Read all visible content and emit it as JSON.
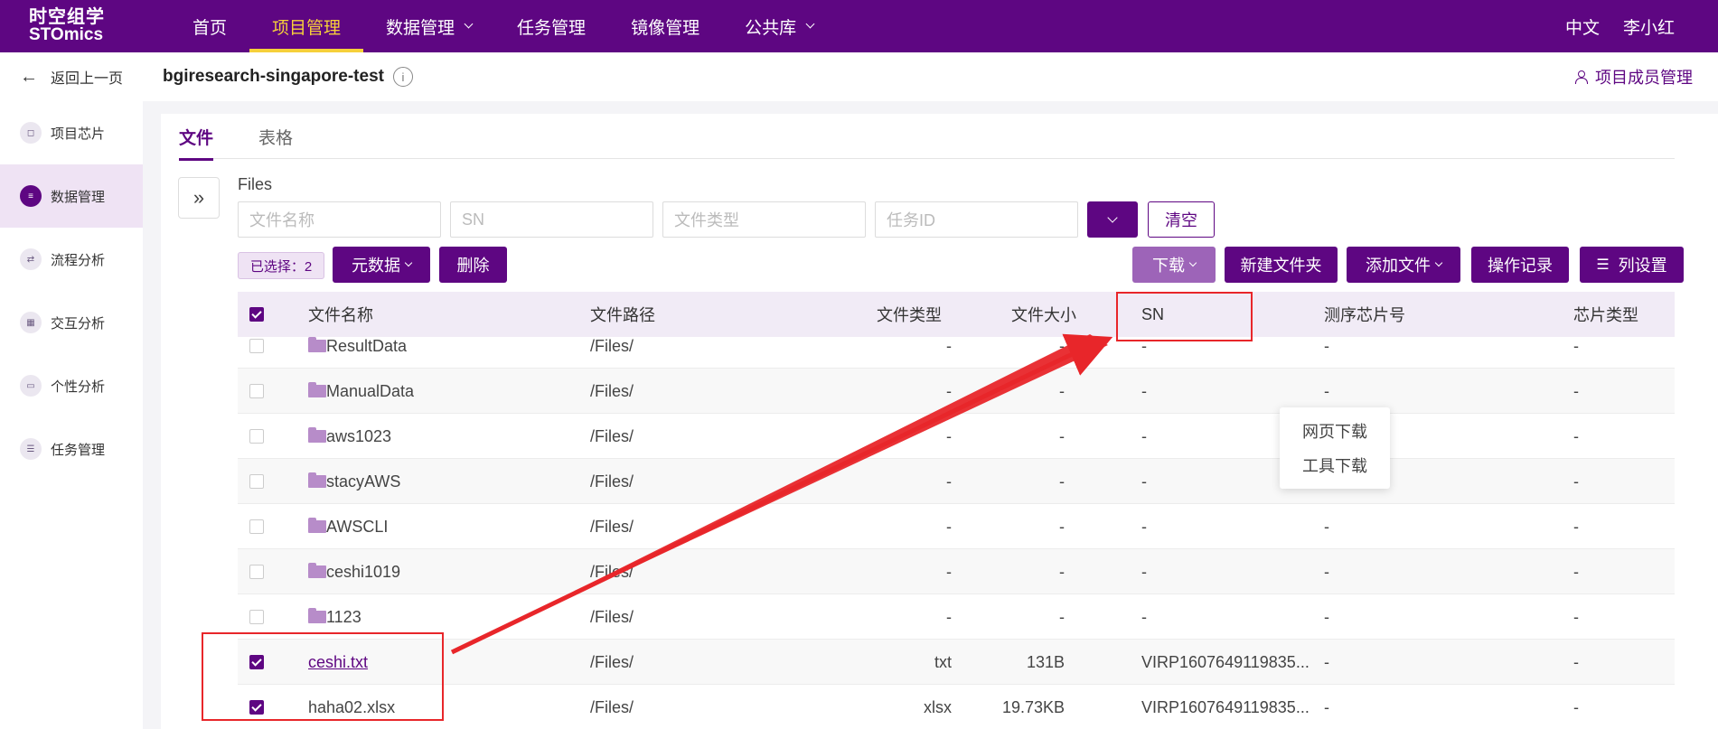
{
  "brand": {
    "line1": "时空组学",
    "line2": "STOmics"
  },
  "nav": {
    "items": [
      {
        "label": "首页",
        "active": false,
        "dropdown": false
      },
      {
        "label": "项目管理",
        "active": true,
        "dropdown": false
      },
      {
        "label": "数据管理",
        "active": false,
        "dropdown": true
      },
      {
        "label": "任务管理",
        "active": false,
        "dropdown": false
      },
      {
        "label": "镜像管理",
        "active": false,
        "dropdown": false
      },
      {
        "label": "公共库",
        "active": false,
        "dropdown": true
      }
    ],
    "lang": "中文",
    "user": "李小红"
  },
  "sidebar": {
    "back_label": "返回上一页",
    "items": [
      {
        "label": "项目芯片",
        "icon": "chip-icon"
      },
      {
        "label": "数据管理",
        "icon": "database-icon",
        "active": true
      },
      {
        "label": "流程分析",
        "icon": "workflow-icon"
      },
      {
        "label": "交互分析",
        "icon": "interactive-icon"
      },
      {
        "label": "个性分析",
        "icon": "monitor-icon"
      },
      {
        "label": "任务管理",
        "icon": "task-icon"
      }
    ]
  },
  "header": {
    "project_title": "bgiresearch-singapore-test",
    "members_label": "项目成员管理"
  },
  "tabs": [
    {
      "label": "文件",
      "active": true
    },
    {
      "label": "表格",
      "active": false
    }
  ],
  "files_label": "Files",
  "filters": {
    "filename_placeholder": "文件名称",
    "sn_placeholder": "SN",
    "filetype_placeholder": "文件类型",
    "taskid_placeholder": "任务ID",
    "clear_label": "清空"
  },
  "toolbar": {
    "selected_label": "已选择：2",
    "metadata_label": "元数据",
    "delete_label": "删除",
    "download_label": "下载",
    "new_folder_label": "新建文件夹",
    "add_file_label": "添加文件",
    "operation_log_label": "操作记录",
    "column_settings_label": "列设置"
  },
  "download_menu": {
    "web_download": "网页下载",
    "tool_download": "工具下载"
  },
  "table": {
    "columns": [
      "文件名称",
      "文件路径",
      "文件类型",
      "文件大小",
      "SN",
      "测序芯片号",
      "芯片类型"
    ],
    "rows": [
      {
        "name": "ResultData",
        "path": "/Files/",
        "type": "-",
        "size": "-",
        "sn": "-",
        "seq_chip": "-",
        "chip_type": "-",
        "folder": true,
        "checked": false
      },
      {
        "name": "ManualData",
        "path": "/Files/",
        "type": "-",
        "size": "-",
        "sn": "-",
        "seq_chip": "-",
        "chip_type": "-",
        "folder": true,
        "checked": false
      },
      {
        "name": "aws1023",
        "path": "/Files/",
        "type": "-",
        "size": "-",
        "sn": "-",
        "seq_chip": "-",
        "chip_type": "-",
        "folder": true,
        "checked": false
      },
      {
        "name": "stacyAWS",
        "path": "/Files/",
        "type": "-",
        "size": "-",
        "sn": "-",
        "seq_chip": "-",
        "chip_type": "-",
        "folder": true,
        "checked": false
      },
      {
        "name": "AWSCLI",
        "path": "/Files/",
        "type": "-",
        "size": "-",
        "sn": "-",
        "seq_chip": "-",
        "chip_type": "-",
        "folder": true,
        "checked": false
      },
      {
        "name": "ceshi1019",
        "path": "/Files/",
        "type": "-",
        "size": "-",
        "sn": "-",
        "seq_chip": "-",
        "chip_type": "-",
        "folder": true,
        "checked": false
      },
      {
        "name": "1123",
        "path": "/Files/",
        "type": "-",
        "size": "-",
        "sn": "-",
        "seq_chip": "-",
        "chip_type": "-",
        "folder": true,
        "checked": false
      },
      {
        "name": "ceshi.txt",
        "path": "/Files/",
        "type": "txt",
        "size": "131B",
        "sn": "VIRP1607649119835...",
        "seq_chip": "-",
        "chip_type": "-",
        "folder": false,
        "checked": true,
        "link": true
      },
      {
        "name": "haha02.xlsx",
        "path": "/Files/",
        "type": "xlsx",
        "size": "19.73KB",
        "sn": "VIRP1607649119835...",
        "seq_chip": "-",
        "chip_type": "-",
        "folder": false,
        "checked": true
      }
    ]
  },
  "colors": {
    "brand": "#5e0682",
    "active_nav": "#f6d03a",
    "annotation": "#e8262a"
  }
}
